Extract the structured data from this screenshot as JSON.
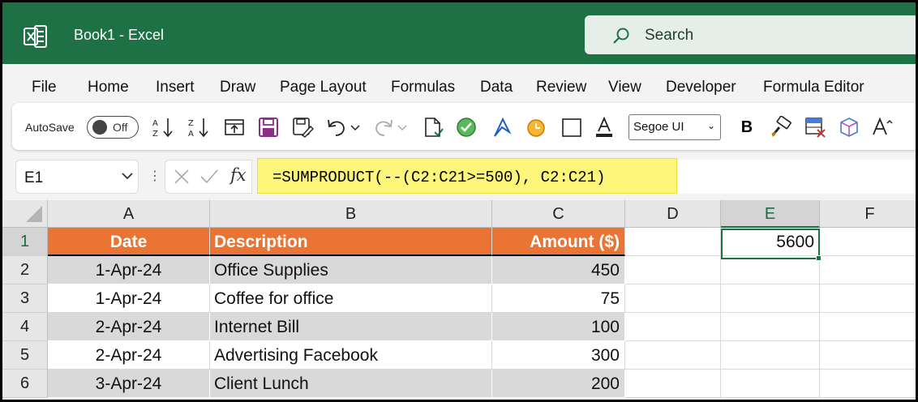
{
  "window": {
    "title": "Book1  -  Excel",
    "search_placeholder": "Search",
    "brand_color": "#1e7145"
  },
  "menu": [
    "File",
    "Home",
    "Insert",
    "Draw",
    "Page Layout",
    "Formulas",
    "Data",
    "Review",
    "View",
    "Developer",
    "Formula Editor"
  ],
  "toolbar": {
    "autosave_label": "AutoSave",
    "autosave_state": "Off",
    "font": "Segoe UI",
    "bold_label": "B",
    "icons": [
      "sort-ascending-icon",
      "sort-descending-icon",
      "import-icon",
      "save-icon",
      "save-as-icon",
      "undo-icon",
      "redo-icon",
      "new-document-icon",
      "check-circle-icon",
      "ink-pen-icon",
      "timer-icon",
      "border-box-icon",
      "font-color-icon",
      "format-painter-icon",
      "clear-format-icon",
      "cube-icon",
      "font-size-icon"
    ]
  },
  "formula_bar": {
    "name_box": "E1",
    "fx_label": "fx",
    "formula": "=SUMPRODUCT(--(C2:C21>=500), C2:C21)",
    "highlight_color": "#fef57b"
  },
  "sheet": {
    "columns": [
      "A",
      "B",
      "C",
      "D",
      "E",
      "F"
    ],
    "selected_column": "E",
    "rows": [
      "1",
      "2",
      "3",
      "4",
      "5",
      "6"
    ],
    "selected_row": "1",
    "header_fill": "#ea7434",
    "headers": {
      "date": "Date",
      "description": "Description",
      "amount": "Amount ($)"
    },
    "data": [
      {
        "date": "1-Apr-24",
        "description": "Office Supplies",
        "amount": "450"
      },
      {
        "date": "1-Apr-24",
        "description": "Coffee for office",
        "amount": "75"
      },
      {
        "date": "2-Apr-24",
        "description": "Internet Bill",
        "amount": "100"
      },
      {
        "date": "2-Apr-24",
        "description": "Advertising Facebook",
        "amount": "300"
      },
      {
        "date": "3-Apr-24",
        "description": "Client Lunch",
        "amount": "200"
      }
    ],
    "result_cell": {
      "ref": "E1",
      "value": "5600"
    }
  }
}
